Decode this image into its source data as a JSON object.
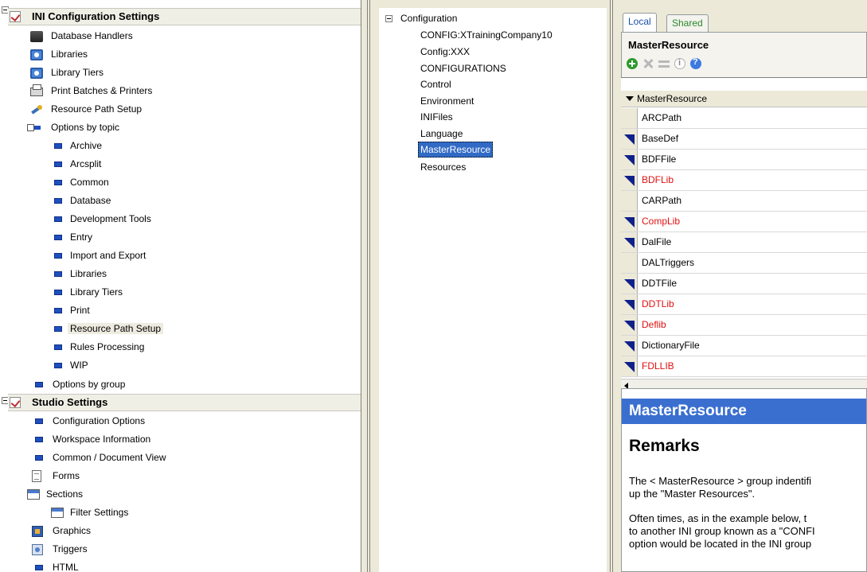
{
  "ini_section": {
    "title": "INI Configuration Settings",
    "items": [
      {
        "label": "Database Handlers",
        "icon": "database-icon"
      },
      {
        "label": "Libraries",
        "icon": "library-icon"
      },
      {
        "label": "Library Tiers",
        "icon": "library-icon"
      },
      {
        "label": "Print Batches & Printers",
        "icon": "printer-icon"
      },
      {
        "label": "Resource Path Setup",
        "icon": "tool-icon"
      }
    ],
    "options_by_topic": {
      "label": "Options by topic",
      "children": [
        "Archive",
        "Arcsplit",
        "Common",
        "Database",
        "Development Tools",
        "Entry",
        "Import and Export",
        "Libraries",
        "Library Tiers",
        "Print",
        "Resource Path Setup",
        "Rules Processing",
        "WIP"
      ],
      "selected": "Resource Path Setup"
    },
    "options_by_group": "Options by group"
  },
  "studio_section": {
    "title": "Studio Settings",
    "items": [
      "Configuration Options",
      "Workspace Information",
      "Common / Document View",
      "Forms",
      "Sections",
      "Filter Settings",
      "Graphics",
      "Triggers",
      "HTML"
    ]
  },
  "config_tree": {
    "root": "Configuration",
    "children": [
      "CONFIG:XTrainingCompany10",
      "Config:XXX",
      "CONFIGURATIONS",
      "Control",
      "Environment",
      "INIFiles",
      "Language",
      "MasterResource",
      "Resources"
    ],
    "selected": "MasterResource"
  },
  "right_panel": {
    "tabs": [
      "Local",
      "Shared"
    ],
    "title": "MasterResource",
    "grid_header": "MasterResource",
    "rows": [
      {
        "label": "ARCPath",
        "flag": false,
        "red": false
      },
      {
        "label": "BaseDef",
        "flag": true,
        "red": false
      },
      {
        "label": "BDFFile",
        "flag": true,
        "red": false
      },
      {
        "label": "BDFLib",
        "flag": true,
        "red": true
      },
      {
        "label": "CARPath",
        "flag": false,
        "red": false
      },
      {
        "label": "CompLib",
        "flag": true,
        "red": true
      },
      {
        "label": "DalFile",
        "flag": true,
        "red": false
      },
      {
        "label": "DALTriggers",
        "flag": false,
        "red": false
      },
      {
        "label": "DDTFile",
        "flag": true,
        "red": false
      },
      {
        "label": "DDTLib",
        "flag": true,
        "red": true
      },
      {
        "label": "Deflib",
        "flag": true,
        "red": true
      },
      {
        "label": "DictionaryFile",
        "flag": true,
        "red": false
      },
      {
        "label": "FDLLIB",
        "flag": true,
        "red": true
      }
    ]
  },
  "help": {
    "title": "MasterResource",
    "heading": "Remarks",
    "para1_line1": "The < MasterResource > group indentifi",
    "para1_line2": "up the \"Master Resources\".",
    "para2_line1": "Often times, as in the example below, t",
    "para2_line2": "to another INI group known as a \"CONFI",
    "para2_line3": "option would be located in the INI group"
  },
  "colors": {
    "selection": "#316ac5",
    "red_text": "#e01010",
    "help_bar": "#3a6fd0",
    "flag": "#10208a"
  }
}
